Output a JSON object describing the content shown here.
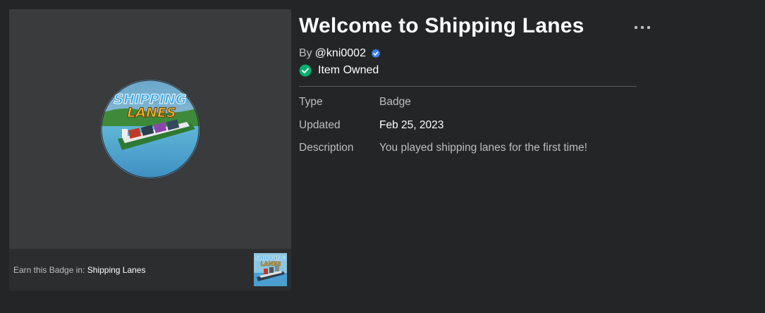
{
  "badge": {
    "title": "Welcome to Shipping Lanes",
    "badge_logo_line1": "SHIPPING",
    "badge_logo_line2": "LANES"
  },
  "creator": {
    "by_label": "By",
    "name": "@kni0002"
  },
  "ownership": {
    "label": "Item Owned"
  },
  "details": [
    {
      "label": "Type",
      "value": "Badge"
    },
    {
      "label": "Updated",
      "value": "Feb 25, 2023"
    },
    {
      "label": "Description",
      "value": "You played shipping lanes for the first time!"
    }
  ],
  "earn": {
    "prefix": "Earn this Badge in:",
    "game_name": "Shipping Lanes",
    "thumb_logo_line1": "SHIPPING",
    "thumb_logo_line2": "LANES"
  },
  "colors": {
    "background": "#232527",
    "card": "#393b3d",
    "verified": "#3b82f6",
    "owned_check": "#00b06f"
  },
  "icons": [
    "more-options-icon",
    "verified-badge-icon",
    "check-circle-icon"
  ]
}
